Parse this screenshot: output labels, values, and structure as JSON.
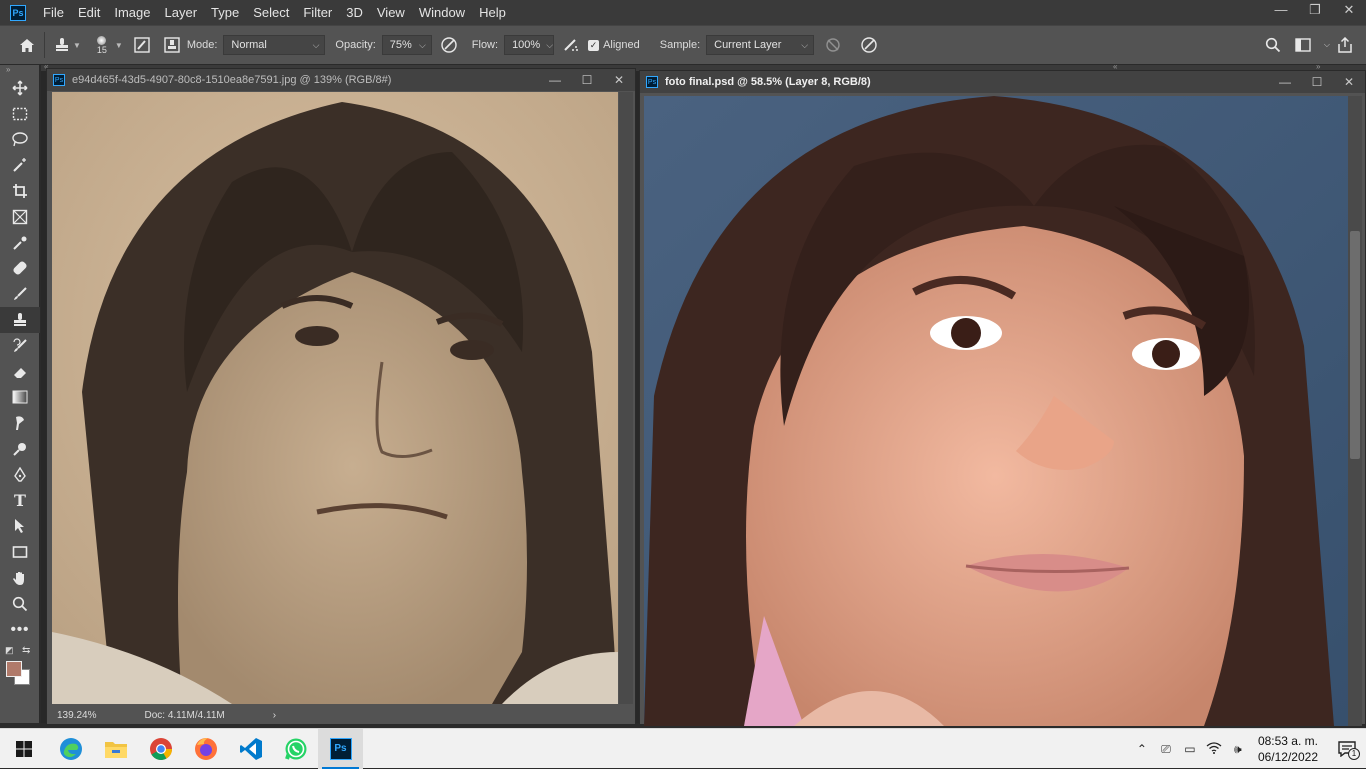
{
  "app": {
    "logo": "Ps"
  },
  "menu": [
    "File",
    "Edit",
    "Image",
    "Layer",
    "Type",
    "Select",
    "Filter",
    "3D",
    "View",
    "Window",
    "Help"
  ],
  "window_controls": {
    "minimize": "—",
    "restore": "❐",
    "close": "✕"
  },
  "options": {
    "brush_size": "15",
    "mode_label": "Mode:",
    "mode_value": "Normal",
    "opacity_label": "Opacity:",
    "opacity_value": "75%",
    "flow_label": "Flow:",
    "flow_value": "100%",
    "aligned_label": "Aligned",
    "aligned_checked": true,
    "sample_label": "Sample:",
    "sample_value": "Current Layer"
  },
  "tools": [
    {
      "name": "move-tool",
      "icon": "move-icon"
    },
    {
      "name": "marquee-tool",
      "icon": "marquee-icon"
    },
    {
      "name": "lasso-tool",
      "icon": "lasso-icon"
    },
    {
      "name": "magic-wand-tool",
      "icon": "magic-wand-icon"
    },
    {
      "name": "crop-tool",
      "icon": "crop-icon"
    },
    {
      "name": "frame-tool",
      "icon": "frame-icon"
    },
    {
      "name": "eyedropper-tool",
      "icon": "eyedropper-icon"
    },
    {
      "name": "healing-brush-tool",
      "icon": "bandage-icon"
    },
    {
      "name": "brush-tool",
      "icon": "brush-icon"
    },
    {
      "name": "clone-stamp-tool",
      "icon": "stamp-icon",
      "active": true
    },
    {
      "name": "history-brush-tool",
      "icon": "history-brush-icon"
    },
    {
      "name": "eraser-tool",
      "icon": "eraser-icon"
    },
    {
      "name": "gradient-tool",
      "icon": "gradient-icon"
    },
    {
      "name": "smudge-tool",
      "icon": "smudge-icon"
    },
    {
      "name": "dodge-tool",
      "icon": "dodge-icon"
    },
    {
      "name": "pen-tool",
      "icon": "pen-icon"
    },
    {
      "name": "type-tool",
      "icon": "type-icon"
    },
    {
      "name": "path-selection-tool",
      "icon": "arrow-icon"
    },
    {
      "name": "rectangle-tool",
      "icon": "rectangle-icon"
    },
    {
      "name": "hand-tool",
      "icon": "hand-icon"
    },
    {
      "name": "zoom-tool",
      "icon": "zoom-icon"
    },
    {
      "name": "more-tools",
      "icon": "ellipsis-icon"
    }
  ],
  "colors": {
    "foreground": "#b07a6a",
    "background": "#ffffff"
  },
  "documents": [
    {
      "title": "e94d465f-43d5-4907-80c8-1510ea8e7591.jpg @ 139% (RGB/8#)",
      "zoom": "139.24%",
      "doc_info": "Doc: 4.11M/4.11M",
      "active": false
    },
    {
      "title": "foto final.psd @ 58.5% (Layer 8, RGB/8)",
      "active": true
    }
  ],
  "taskbar": {
    "apps": [
      "start",
      "edge",
      "file-explorer",
      "chrome",
      "firefox",
      "vscode",
      "whatsapp",
      "photoshop"
    ],
    "time": "08:53 a. m.",
    "date": "06/12/2022",
    "notification_count": "1"
  }
}
